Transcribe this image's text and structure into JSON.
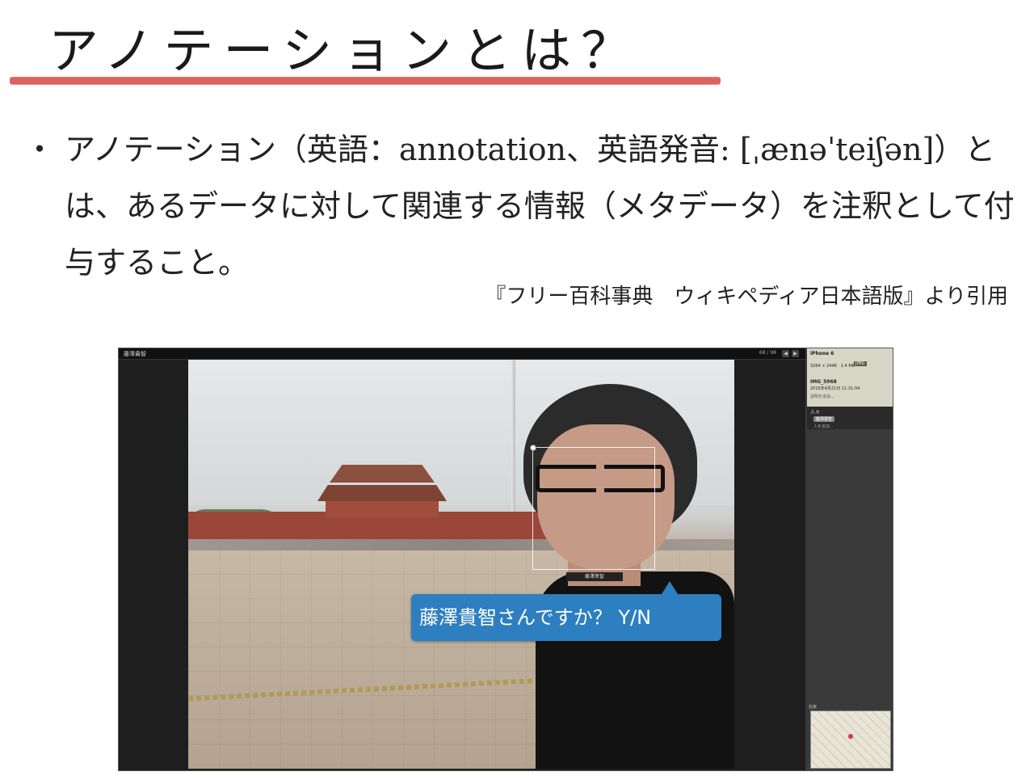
{
  "slide": {
    "title": "アノテーションとは？",
    "bullet_marker": "・",
    "bullet_text": "アノテーション（英語：annotation、英語発音: [ˌænəˈteiʃən]）とは、あるデータに対して関連する情報（メタデータ）を注釈として付与すること。",
    "citation": "『フリー百科事典　ウィキペディア日本語版』より引用"
  },
  "colors": {
    "underline": "#d9534f",
    "callout_bg": "#2d7fc0"
  },
  "app": {
    "title": "藤澤貴智",
    "counter": "68 / 98",
    "nav_prev": "◀",
    "nav_next": "▶",
    "callout_text": "藤澤貴智さんですか？ Y/N",
    "face_tag": "藤澤貴智",
    "info": {
      "device": "iPhone 6",
      "specs": "3264 × 2448　1.4 MB",
      "format": "JPEG",
      "filename": "IMG_5968",
      "date": "2015年4月21日 11:31:04",
      "description": "説明を追加..."
    },
    "people": {
      "header": "人々",
      "person": "藤澤貴智",
      "add_label": "人を追加..."
    },
    "map_label": "北京"
  }
}
